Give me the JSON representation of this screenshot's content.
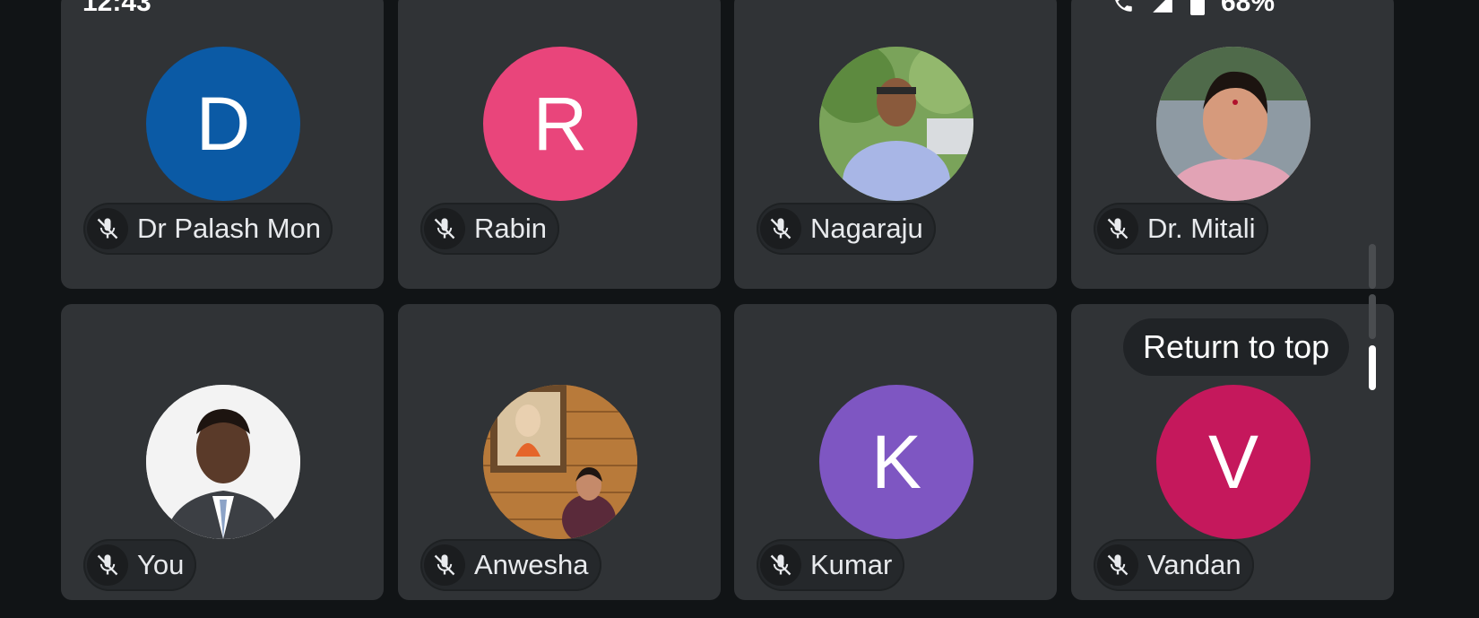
{
  "status_bar": {
    "time": "12:43",
    "battery_text": "68%"
  },
  "participants": [
    {
      "name": "Dr Palash Mon",
      "initial": "D",
      "color": "#0b5aa5",
      "photo": false
    },
    {
      "name": "Rabin",
      "initial": "R",
      "color": "#e9457b",
      "photo": false
    },
    {
      "name": "Nagaraju",
      "initial": "",
      "color": "#6d8f4e",
      "photo": true
    },
    {
      "name": "Dr. Mitali",
      "initial": "",
      "color": "#c98c72",
      "photo": true
    },
    {
      "name": "You",
      "initial": "",
      "color": "#f0f0f0",
      "photo": true
    },
    {
      "name": "Anwesha",
      "initial": "",
      "color": "#b46e34",
      "photo": true
    },
    {
      "name": "Kumar",
      "initial": "K",
      "color": "#7e56c2",
      "photo": false
    },
    {
      "name": "Vandan",
      "initial": "V",
      "color": "#c5185c",
      "photo": false
    }
  ],
  "return_to_top": "Return to top",
  "icons": {
    "muted": "mic-off-icon"
  }
}
